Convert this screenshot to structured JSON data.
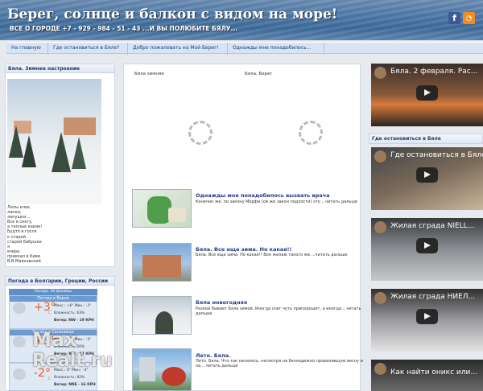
{
  "header": {
    "title": "Берег, солнце и балкон с видом на море!",
    "subtitle": "ВСЕ О ГОРОДЕ +7 - 929 - 984 - 51 - 43 ...И ВЫ ПОЛЮБИТЕ БЯЛУ...",
    "social": {
      "facebook": "f",
      "rss": "◔"
    }
  },
  "nav": {
    "items": [
      {
        "label": "На главную"
      },
      {
        "label": "Где остановиться в Бяле?"
      },
      {
        "label": "Добро пожаловать на Мой Берег!"
      },
      {
        "label": "Однажды мне понадобилось..."
      }
    ]
  },
  "left": {
    "winter_title": "Бяла. Зимнее настроение",
    "poem": [
      "Лапы елок,",
      "лапки,",
      "лапушки...",
      "Все в снегу,",
      "а теплые какие!",
      "Будто в гости",
      "к старой,",
      "старой бабушке",
      "я",
      "вчера",
      "приехал в Киев",
      "В.В.Маяковский"
    ],
    "weather_title": "Погода в Болгарии, Греции, России",
    "weather_date": "Погода, 28 Декабрь",
    "cities": [
      {
        "name": "Погода в Варне",
        "temp": "+3°",
        "unit": "C",
        "minmax": "Макс.: +6° Мин.: -3°",
        "humidity": "Влажность: 63%",
        "wind": "Ветер: NW - 19 КРН"
      },
      {
        "name": "Погода в Салониках",
        "temp": "+3°",
        "unit": "C",
        "minmax": "Макс.: +9° Мин.: -3°",
        "humidity": "Влажность: 56%",
        "wind": "Ветер: NW - 27 КРН"
      },
      {
        "name": "",
        "temp": "-2°",
        "unit": "C",
        "minmax": "Макс.: 0° Мин.: -4°",
        "humidity": "Влажность: 82%",
        "wind": "Ветер: NNE - 16 КРН"
      }
    ]
  },
  "center": {
    "widget_labels": [
      "Бяла зимняя",
      "Бяла. Берег"
    ],
    "articles": [
      {
        "title": "Однажды мне понадобилось вызвать врача",
        "text": "Конечно же, по закону Мерфи (ой же закон подлости) это ...читать дальше"
      },
      {
        "title": "Бяла. Все еще зима. Но какая!!",
        "text": "Бяла. Все еще зима. Но какая!! Вон желаю такого же ...читать дальше"
      },
      {
        "title": "Бяла новогодняя",
        "text": "Разной бывает Бяла зимой. Иногда снег чуть припорошит, а иногда ...читать дальше"
      },
      {
        "title": "Лето. Бяла.",
        "text": "Лето. Бяла. Что-так началось, несмотря на безнадежно провалившую весну и на ...читать дальше"
      }
    ]
  },
  "right": {
    "stay_title": "Где остановиться в Бяле",
    "videos": [
      {
        "title": "Бяла. 2 февраля. Рас..."
      },
      {
        "title": "Где остановиться в Бяле"
      },
      {
        "title": "Жилая сграда NIELL..."
      },
      {
        "title": "Жилая сграда НИЕЛ..."
      },
      {
        "title": "Как найти оникс или..."
      }
    ]
  },
  "watermark": {
    "line1": "Max",
    "line2": "Realt.ru"
  }
}
